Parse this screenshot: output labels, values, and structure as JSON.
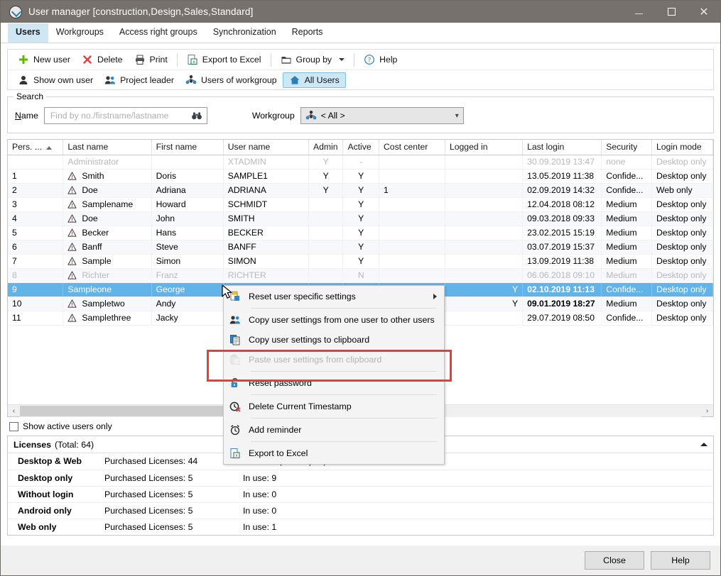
{
  "window": {
    "title": "User manager [construction,Design,Sales,Standard]",
    "icon": "clock-app-icon",
    "minimize": "—",
    "maximize": "□",
    "close": "✕"
  },
  "tabs": [
    {
      "label": "Users",
      "active": true
    },
    {
      "label": "Workgroups",
      "active": false
    },
    {
      "label": "Access right groups",
      "active": false
    },
    {
      "label": "Synchronization",
      "active": false
    },
    {
      "label": "Reports",
      "active": false
    }
  ],
  "toolbar": {
    "row1": [
      {
        "label": "New user",
        "icon": "plus-icon"
      },
      {
        "label": "Delete",
        "icon": "x-delete-icon"
      },
      {
        "label": "Print",
        "icon": "printer-icon"
      },
      {
        "label": "Export to Excel",
        "icon": "excel-icon"
      },
      {
        "label": "Group by",
        "icon": "folder-icon",
        "dropdown": true
      },
      {
        "label": "Help",
        "icon": "question-circle-icon"
      }
    ],
    "row2": [
      {
        "label": "Show own user",
        "icon": "person-icon",
        "selected": false
      },
      {
        "label": "Project leader",
        "icon": "people-icon",
        "selected": false
      },
      {
        "label": "Users of workgroup",
        "icon": "group-icon",
        "selected": false
      },
      {
        "label": "All Users",
        "icon": "home-icon",
        "selected": true
      }
    ]
  },
  "search": {
    "legend": "Search",
    "name_label": "Name",
    "name_value": "",
    "name_placeholder": "Find by no./firstname/lastname",
    "binoculars_icon": "binoculars-icon",
    "workgroup_label": "Workgroup",
    "workgroup_value": "< All >",
    "workgroup_icon": "group-icon"
  },
  "grid": {
    "columns": [
      "Pers. ...",
      "Last name",
      "First name",
      "User name",
      "Admin",
      "Active",
      "Cost center",
      "Logged in",
      "Last login",
      "Security",
      "Login mode"
    ],
    "sorted_column": 0,
    "sort_direction": "asc",
    "rows": [
      {
        "no": "",
        "last": "Administrator",
        "first": "",
        "user": "XTADMIN",
        "admin": "Y",
        "active": "-",
        "cost": "",
        "logged": "",
        "login": "30.09.2019 13:47",
        "security": "none",
        "mode": "Desktop only",
        "state": "dim",
        "warn": false,
        "bold": false
      },
      {
        "no": "1",
        "last": "Smith",
        "first": "Doris",
        "user": "SAMPLE1",
        "admin": "Y",
        "active": "Y",
        "cost": "",
        "logged": "",
        "login": "13.05.2019 11:38",
        "security": "Confide...",
        "mode": "Desktop only",
        "state": "",
        "warn": true,
        "bold": false
      },
      {
        "no": "2",
        "last": "Doe",
        "first": "Adriana",
        "user": "ADRIANA",
        "admin": "Y",
        "active": "Y",
        "cost": "1",
        "logged": "",
        "login": "02.09.2019 14:32",
        "security": "Confide...",
        "mode": "Web only",
        "state": "alt",
        "warn": true,
        "bold": false
      },
      {
        "no": "3",
        "last": "Samplename",
        "first": "Howard",
        "user": "SCHMIDT",
        "admin": "",
        "active": "Y",
        "cost": "",
        "logged": "",
        "login": "12.04.2018 08:12",
        "security": "Medium",
        "mode": "Desktop only",
        "state": "",
        "warn": true,
        "bold": false
      },
      {
        "no": "4",
        "last": "Doe",
        "first": "John",
        "user": "SMITH",
        "admin": "",
        "active": "Y",
        "cost": "",
        "logged": "",
        "login": "09.03.2018 09:33",
        "security": "Medium",
        "mode": "Desktop only",
        "state": "alt",
        "warn": true,
        "bold": false
      },
      {
        "no": "5",
        "last": "Becker",
        "first": "Hans",
        "user": "BECKER",
        "admin": "",
        "active": "Y",
        "cost": "",
        "logged": "",
        "login": "23.02.2015 15:19",
        "security": "Medium",
        "mode": "Desktop only",
        "state": "",
        "warn": true,
        "bold": false
      },
      {
        "no": "6",
        "last": "Banff",
        "first": "Steve",
        "user": "BANFF",
        "admin": "",
        "active": "Y",
        "cost": "",
        "logged": "",
        "login": "03.07.2019 15:37",
        "security": "Medium",
        "mode": "Desktop only",
        "state": "alt",
        "warn": true,
        "bold": false
      },
      {
        "no": "7",
        "last": "Sample",
        "first": "Simon",
        "user": "SIMON",
        "admin": "",
        "active": "Y",
        "cost": "",
        "logged": "",
        "login": "13.09.2019 11:38",
        "security": "Medium",
        "mode": "Desktop only",
        "state": "",
        "warn": true,
        "bold": false
      },
      {
        "no": "8",
        "last": "Richter",
        "first": "Franz",
        "user": "RICHTER",
        "admin": "",
        "active": "N",
        "cost": "",
        "logged": "",
        "login": "06.06.2018 09:10",
        "security": "Medium",
        "mode": "Desktop only",
        "state": "dim alt",
        "warn": true,
        "bold": false
      },
      {
        "no": "9",
        "last": "Sampleone",
        "first": "George",
        "user": "",
        "admin": "",
        "active": "",
        "cost": "",
        "logged": "Y",
        "login": "02.10.2019 11:13",
        "security": "Confide...",
        "mode": "Desktop only",
        "state": "sel",
        "warn": false,
        "bold": true
      },
      {
        "no": "10",
        "last": "Sampletwo",
        "first": "Andy",
        "user": "",
        "admin": "",
        "active": "",
        "cost": "",
        "logged": "Y",
        "login": "09.01.2019 18:27",
        "security": "Medium",
        "mode": "Desktop only",
        "state": "alt",
        "warn": true,
        "bold": true
      },
      {
        "no": "11",
        "last": "Samplethree",
        "first": "Jacky",
        "user": "",
        "admin": "",
        "active": "",
        "cost": "",
        "logged": "",
        "login": "29.07.2019 08:50",
        "security": "Confide...",
        "mode": "Desktop only",
        "state": "",
        "warn": true,
        "bold": false
      }
    ],
    "scroll_left_arrow": "‹",
    "scroll_right_arrow": "›"
  },
  "show_active_only": {
    "label": "Show active users only",
    "checked": false
  },
  "licenses": {
    "title": "Licenses",
    "total": "(Total: 64)",
    "collapse_icon": "arrow-up-icon",
    "rows": [
      {
        "kind": "Desktop & Web",
        "purchased": "Purchased Licenses: 44",
        "inuse": "In use: 0 (Desktop: 4)"
      },
      {
        "kind": "Desktop only",
        "purchased": "Purchased Licenses: 5",
        "inuse": "In use: 9"
      },
      {
        "kind": "Without login",
        "purchased": "Purchased Licenses: 5",
        "inuse": "In use: 0"
      },
      {
        "kind": "Android only",
        "purchased": "Purchased Licenses: 5",
        "inuse": "In use: 0"
      },
      {
        "kind": "Web only",
        "purchased": "Purchased Licenses: 5",
        "inuse": "In use: 1"
      }
    ]
  },
  "footer": {
    "close": "Close",
    "help": "Help"
  },
  "context_menu": {
    "items": [
      {
        "label": "Reset user specific settings",
        "icon": "reset-settings-icon",
        "submenu": true,
        "disabled": false,
        "separator_after": true
      },
      {
        "label": "Copy user settings from one user to other users",
        "icon": "people-icon",
        "submenu": false,
        "disabled": false,
        "separator_after": false
      },
      {
        "label": "Copy user settings to clipboard",
        "icon": "copy-icon",
        "submenu": false,
        "disabled": false,
        "separator_after": false
      },
      {
        "label": "Paste user settings from clipboard",
        "icon": "paste-icon",
        "submenu": false,
        "disabled": true,
        "separator_after": true
      },
      {
        "label": "Reset password",
        "icon": "unlock-icon",
        "submenu": false,
        "disabled": false,
        "separator_after": true
      },
      {
        "label": "Delete Current Timestamp",
        "icon": "clock-delete-icon",
        "submenu": false,
        "disabled": false,
        "separator_after": true
      },
      {
        "label": "Add reminder",
        "icon": "alarm-clock-icon",
        "submenu": false,
        "disabled": false,
        "separator_after": true
      },
      {
        "label": "Export to Excel",
        "icon": "excel-icon",
        "submenu": false,
        "disabled": false,
        "separator_after": false
      }
    ]
  },
  "highlight": {
    "target": "Reset password",
    "color": "#ee3b33"
  }
}
